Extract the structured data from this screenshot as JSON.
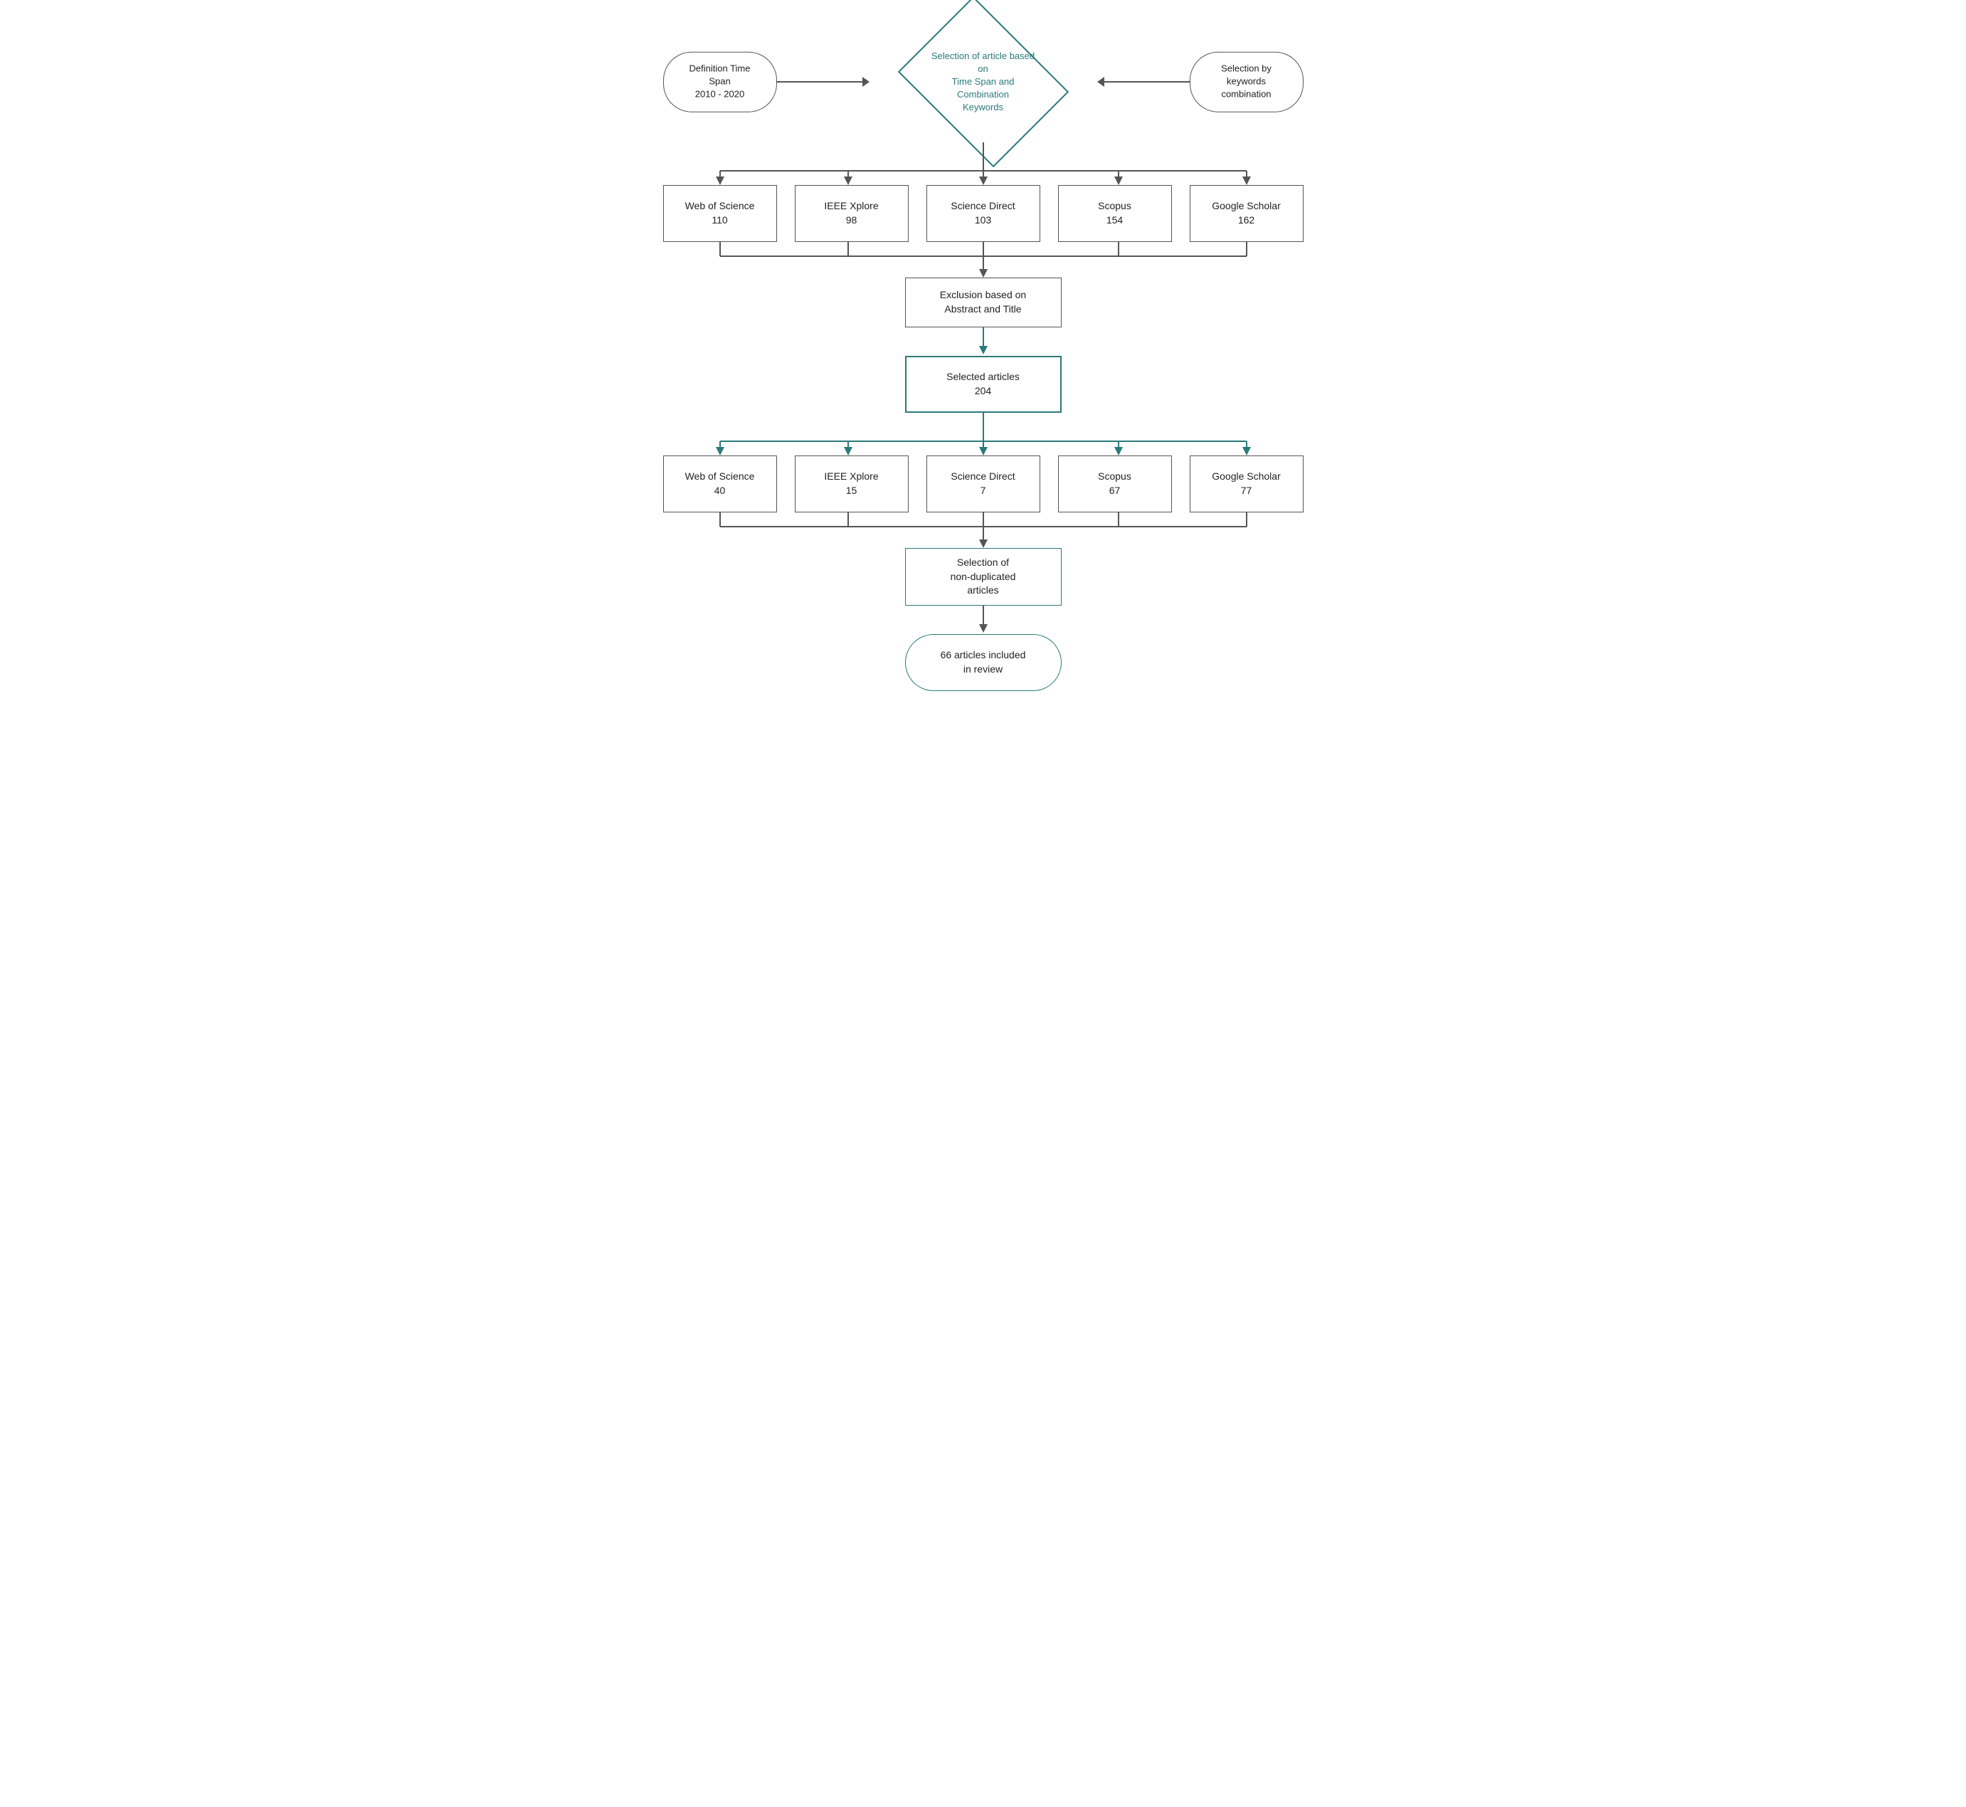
{
  "top": {
    "left_pill": "Definition Time Span\n2010 - 2020",
    "diamond": "Selection of article based on\nTime Span and Combination\nKeywords",
    "right_pill": "Selection by keywords\ncombination"
  },
  "sources_row1": [
    {
      "name": "Web of Science",
      "count": "110"
    },
    {
      "name": "IEEE Xplore",
      "count": "98"
    },
    {
      "name": "Science Direct",
      "count": "103"
    },
    {
      "name": "Scopus",
      "count": "154"
    },
    {
      "name": "Google Scholar",
      "count": "162"
    }
  ],
  "exclusion_box": "Exclusion based on\nAbstract and Title",
  "selected_box": "Selected articles\n204",
  "sources_row2": [
    {
      "name": "Web of Science",
      "count": "40"
    },
    {
      "name": "IEEE Xplore",
      "count": "15"
    },
    {
      "name": "Science Direct",
      "count": "7"
    },
    {
      "name": "Scopus",
      "count": "67"
    },
    {
      "name": "Google Scholar",
      "count": "77"
    }
  ],
  "non_dup_box": "Selection of\nnon-duplicated\narticles",
  "final_pill": "66 articles included\nin review"
}
